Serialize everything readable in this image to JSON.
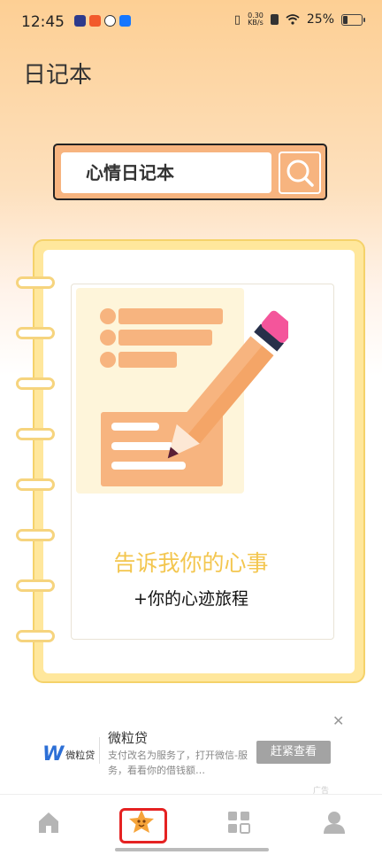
{
  "status_bar": {
    "time": "12:45",
    "net_speed_value": "0.30",
    "net_speed_unit": "KB/s",
    "battery_percent": "25%",
    "notification_icons": [
      "video-app-icon",
      "shop-app-icon",
      "link-app-icon",
      "alipay-app-icon"
    ],
    "battery_level": 0.25
  },
  "app": {
    "title": "日记本"
  },
  "search": {
    "value": "心情日记本"
  },
  "notebook": {
    "headline": "告诉我你的心事",
    "subline": "+你的心迹旅程"
  },
  "ad": {
    "logo_text": "微粒贷",
    "title": "微粒贷",
    "description": "支付改名为服务了，打开微信-服务，看看你的借钱额…",
    "button_label": "赶紧查看",
    "ad_label": "广告"
  },
  "nav": {
    "items": [
      {
        "icon": "home-icon"
      },
      {
        "icon": "star-icon",
        "selected": true
      },
      {
        "icon": "grid-icon"
      },
      {
        "icon": "person-icon"
      }
    ]
  },
  "colors": {
    "accent_orange": "#f7b47f",
    "notebook_yellow": "#ffe79c",
    "headline_yellow": "#f3c64f",
    "selected_outline": "#e52222"
  }
}
